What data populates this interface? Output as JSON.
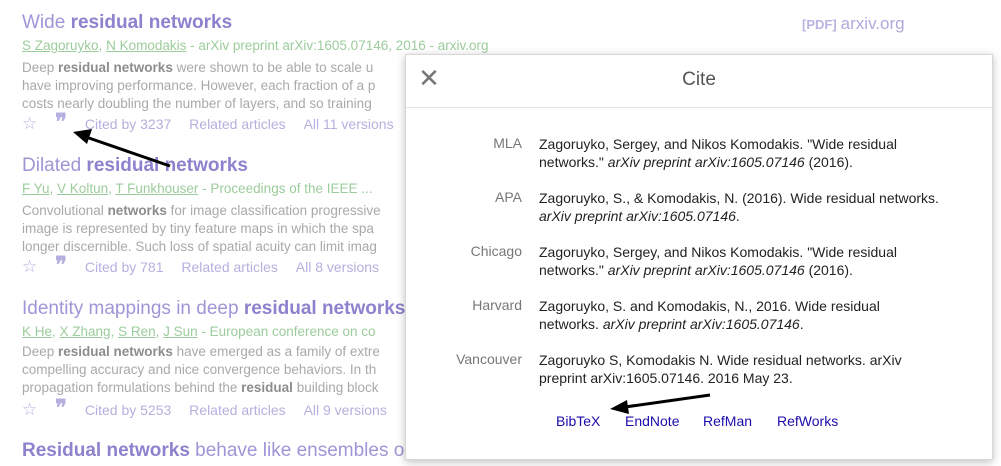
{
  "results": [
    {
      "title_pre": "Wide ",
      "title_bold": "residual networks",
      "title_post": "",
      "authors": [
        "S Zagoruyko",
        "N Komodakis"
      ],
      "source": " - arXiv preprint arXiv:1605.07146, 2016 - arxiv.org",
      "snippet": [
        {
          "pre": "Deep ",
          "bold": "residual networks",
          "post": " were shown to be able to scale u"
        },
        {
          "pre": "have improving performance. However, each fraction of a p",
          "bold": "",
          "post": ""
        },
        {
          "pre": "costs nearly doubling the number of layers, and so training",
          "bold": "",
          "post": ""
        }
      ],
      "cited_by": "Cited by 3237",
      "related": "Related articles",
      "versions": "All 11 versions",
      "pdf_tag": "[PDF]",
      "pdf_site": "arxiv.org"
    },
    {
      "title_pre": "Dilated ",
      "title_bold": "residual networks",
      "title_post": "",
      "authors": [
        "F Yu",
        "V Koltun",
        "T Funkhouser"
      ],
      "source": " - Proceedings of the IEEE ...",
      "snippet": [
        {
          "pre": "Convolutional ",
          "bold": "networks",
          "post": " for image classification progressive"
        },
        {
          "pre": "image is represented by tiny feature maps in which the spa",
          "bold": "",
          "post": ""
        },
        {
          "pre": "longer discernible. Such loss of spatial acuity can limit imag",
          "bold": "",
          "post": ""
        }
      ],
      "cited_by": "Cited by 781",
      "related": "Related articles",
      "versions": "All 8 versions"
    },
    {
      "title_pre": "Identity mappings in deep ",
      "title_bold": "residual networks",
      "title_post": "",
      "authors": [
        "K He",
        "X Zhang",
        "S Ren",
        "J Sun"
      ],
      "source": " - European conference on co",
      "snippet": [
        {
          "pre": "Deep ",
          "bold": "residual networks",
          "post": " have emerged as a family of extre"
        },
        {
          "pre": "compelling accuracy and nice convergence behaviors. In th",
          "bold": "",
          "post": ""
        },
        {
          "pre": "propagation formulations behind the ",
          "bold": "residual",
          "post": " building block"
        }
      ],
      "cited_by": "Cited by 5253",
      "related": "Related articles",
      "versions": "All 9 versions"
    },
    {
      "title_pre": "",
      "title_bold": "Residual networks",
      "title_post": " behave like ensembles o"
    }
  ],
  "cite_dialog": {
    "title": "Cite",
    "close_icon": "close-icon",
    "entries": [
      {
        "label": "MLA",
        "text_pre": "Zagoruyko, Sergey, and Nikos Komodakis. \"Wide residual networks.\" ",
        "text_italic": "arXiv preprint arXiv:1605.07146",
        "text_post": " (2016)."
      },
      {
        "label": "APA",
        "text_pre": "Zagoruyko, S., & Komodakis, N. (2016). Wide residual networks. ",
        "text_italic": "arXiv preprint arXiv:1605.07146",
        "text_post": "."
      },
      {
        "label": "Chicago",
        "text_pre": "Zagoruyko, Sergey, and Nikos Komodakis. \"Wide residual networks.\" ",
        "text_italic": "arXiv preprint arXiv:1605.07146",
        "text_post": " (2016)."
      },
      {
        "label": "Harvard",
        "text_pre": "Zagoruyko, S. and Komodakis, N., 2016. Wide residual networks. ",
        "text_italic": "arXiv preprint arXiv:1605.07146",
        "text_post": "."
      },
      {
        "label": "Vancouver",
        "text_pre": "Zagoruyko S, Komodakis N. Wide residual networks. arXiv preprint arXiv:1605.07146. 2016 May 23.",
        "text_italic": "",
        "text_post": ""
      }
    ],
    "exports": [
      "BibTeX",
      "EndNote",
      "RefMan",
      "RefWorks"
    ]
  },
  "colors": {
    "link": "#1a0dab",
    "faded_title": "#9e96d6",
    "faded_author": "#9ccc9c",
    "arrow": "#000000"
  },
  "icons": {
    "star": "star-icon",
    "quote": "quote-icon"
  }
}
